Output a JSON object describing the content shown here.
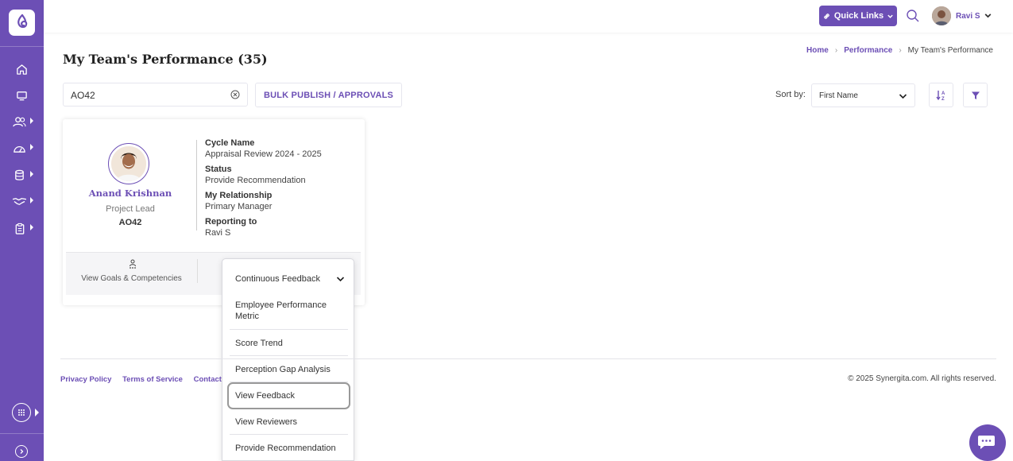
{
  "colors": {
    "brand": "#6c4fb5"
  },
  "sidebar": {
    "items": [
      {
        "name": "home",
        "icon": "home-icon"
      },
      {
        "name": "desktop",
        "icon": "monitor-icon"
      },
      {
        "name": "team",
        "icon": "users-icon"
      },
      {
        "name": "performance",
        "icon": "dashboard-gauge-icon"
      },
      {
        "name": "database",
        "icon": "database-icon"
      },
      {
        "name": "engagement",
        "icon": "handshake-icon"
      },
      {
        "name": "tasks",
        "icon": "clipboard-icon"
      }
    ]
  },
  "topbar": {
    "quick_links": "Quick Links",
    "user_name": "Ravi S"
  },
  "page": {
    "title": "My Team's Performance (35)"
  },
  "breadcrumb": {
    "home": "Home",
    "performance": "Performance",
    "current": "My Team's Performance"
  },
  "toolbar": {
    "search_value": "AO42",
    "bulk_label": "BULK PUBLISH / APPROVALS",
    "sort_label": "Sort by:",
    "sort_value": "First Name"
  },
  "card": {
    "name": "Anand Krishnan",
    "role": "Project Lead",
    "id": "AO42",
    "cycle_label": "Cycle Name",
    "cycle_value": "Appraisal Review 2024 - 2025",
    "status_label": "Status",
    "status_value": "Provide Recommendation",
    "relationship_label": "My Relationship",
    "relationship_value": "Primary Manager",
    "reporting_label": "Reporting to",
    "reporting_value": "Ravi S",
    "goals_label": "View Goals & Competencies"
  },
  "dropdown": {
    "selected": "Continuous Feedback",
    "items": [
      "Employee Performance Metric",
      "Score Trend",
      "Perception Gap Analysis",
      "View Feedback",
      "View Reviewers",
      "Provide Recommendation"
    ]
  },
  "footer": {
    "privacy": "Privacy Policy",
    "terms": "Terms of Service",
    "contact": "Contact",
    "copyright": "© 2025 Synergita.com. All rights reserved."
  }
}
